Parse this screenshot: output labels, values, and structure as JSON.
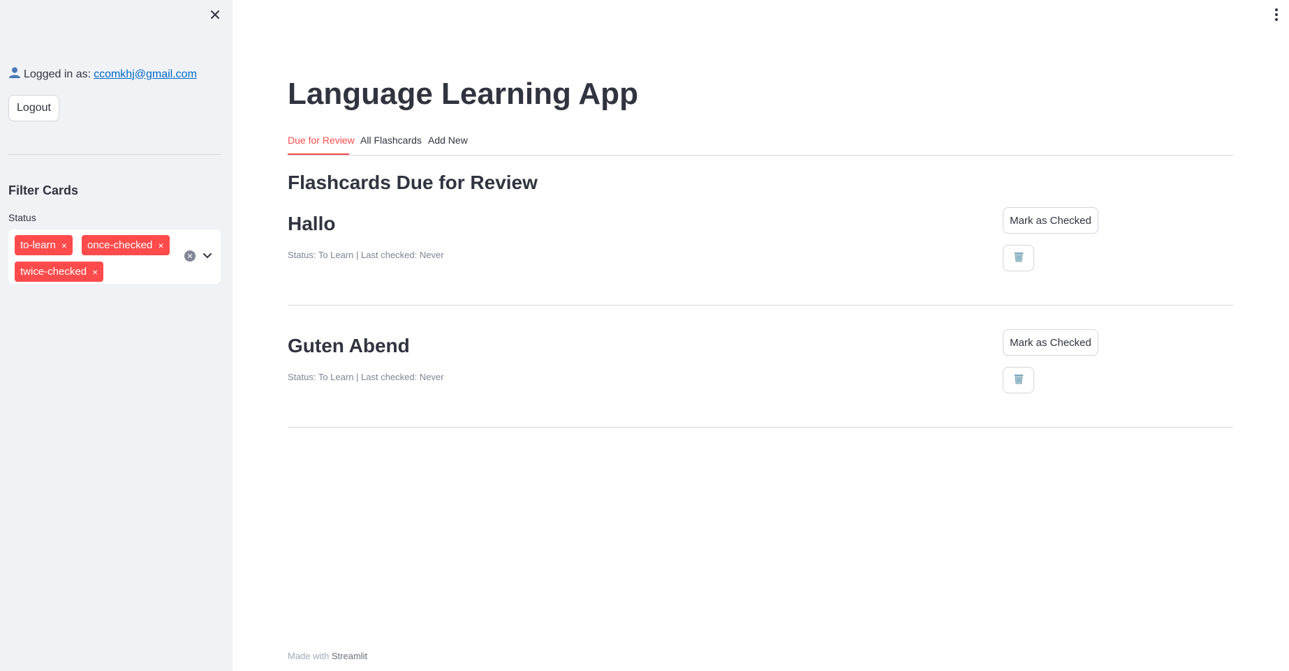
{
  "sidebar": {
    "login_prefix": "Logged in as:",
    "user_email": "ccomkhj@gmail.com",
    "logout_label": "Logout",
    "filter_title": "Filter Cards",
    "status_label": "Status",
    "selected_tags": [
      "to-learn",
      "once-checked",
      "twice-checked"
    ],
    "tag_remove_glyph": "×"
  },
  "main": {
    "title": "Language Learning App",
    "tabs": [
      {
        "label": "Due for Review",
        "active": true
      },
      {
        "label": "All Flashcards",
        "active": false
      },
      {
        "label": "Add New",
        "active": false
      }
    ],
    "section_title": "Flashcards Due for Review",
    "cards": [
      {
        "word": "Hallo",
        "status": "Status: To Learn | Last checked: Never",
        "mark_label": "Mark as Checked"
      },
      {
        "word": "Guten Abend",
        "status": "Status: To Learn | Last checked: Never",
        "mark_label": "Mark as Checked"
      }
    ]
  },
  "footer": {
    "prefix": "Made with",
    "brand": "Streamlit"
  },
  "colors": {
    "accent": "#ff4b4b",
    "sidebar_bg": "#f0f2f6",
    "link": "#0068c9"
  },
  "icons": [
    "close-icon",
    "user-icon",
    "clear-icon",
    "chevron-down-icon",
    "menu-icon",
    "trash-icon"
  ]
}
